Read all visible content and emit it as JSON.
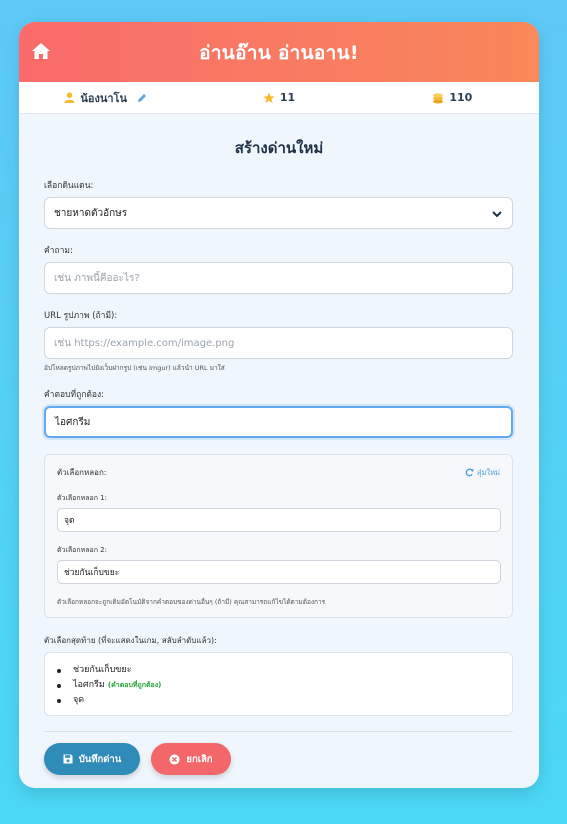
{
  "header": {
    "title": "อ่านอ๊าน อ่านอาน!"
  },
  "stats": {
    "username": "น้องนาโน",
    "stars": "11",
    "coins": "110"
  },
  "form": {
    "title": "สร้างด่านใหม่",
    "land_label": "เลือกดินแดน:",
    "land_value": "ชายหาดตัวอักษร",
    "question_label": "คำถาม:",
    "question_placeholder": "เช่น ภาพนี้คืออะไร?",
    "image_url_label": "URL รูปภาพ (ถ้ามี):",
    "image_url_placeholder": "เช่น https://example.com/image.png",
    "image_url_help": "อัปโหลดรูปภาพไปยังเว็บฝากรูป (เช่น Imgur) แล้วนำ URL มาใส่",
    "answer_label": "คำตอบที่ถูกต้อง:",
    "answer_value": "ไอศกรีม",
    "decoys": {
      "title": "ตัวเลือกหลอก:",
      "random_label": "สุ่มใหม่",
      "items": [
        {
          "label": "ตัวเลือกหลอก 1:",
          "value": "จุด"
        },
        {
          "label": "ตัวเลือกหลอก 2:",
          "value": "ช่วยกันเก็บขยะ"
        }
      ],
      "help": "ตัวเลือกหลอกจะถูกเติมอัตโนมัติจากคำตอบของด่านอื่นๆ (ถ้ามี) คุณสามารถแก้ไขได้ตามต้องการ"
    },
    "final_label": "ตัวเลือกสุดท้าย (ที่จะแสดงในเกม, สลับลำดับแล้ว):",
    "final_options": [
      "ช่วยกันเก็บขยะ",
      "ไอศกรีม",
      "จุด"
    ],
    "correct_tag": "(คำตอบที่ถูกต้อง)",
    "save_label": "บันทึกด่าน",
    "cancel_label": "ยกเลิก"
  },
  "colors": {
    "accent": "#2f8cb8",
    "danger": "#f3666a",
    "header_start": "#f96b6b",
    "header_end": "#f9885a"
  }
}
